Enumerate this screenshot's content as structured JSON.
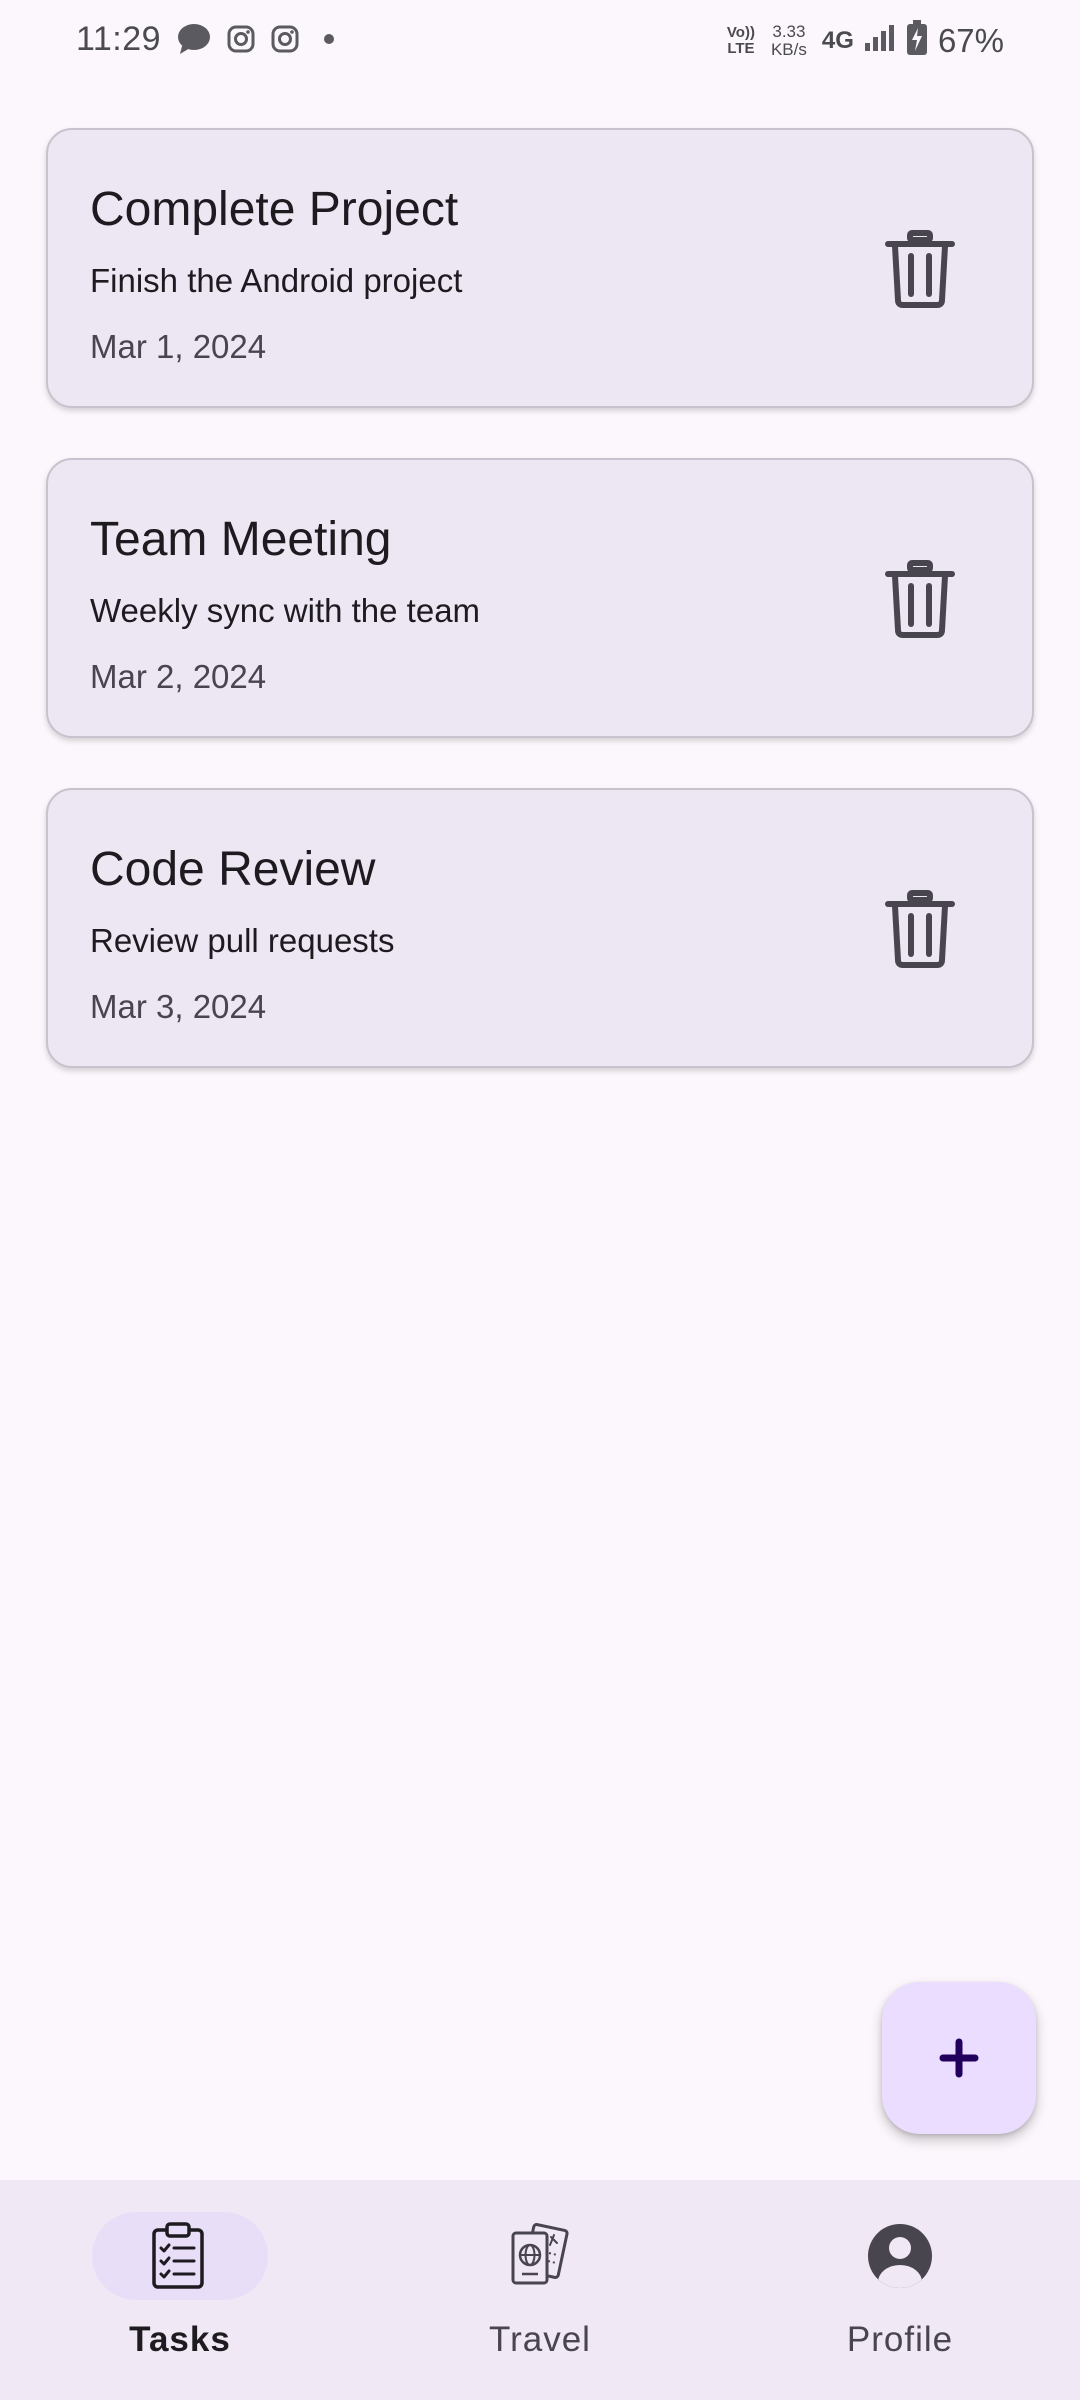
{
  "status_bar": {
    "time": "11:29",
    "volte_top": "Vo))",
    "volte_bottom": "LTE",
    "speed_value": "3.33",
    "speed_unit": "KB/s",
    "network": "4G",
    "battery": "67%",
    "left_icons": [
      "chat-bubble-icon",
      "instagram-icon",
      "instagram-icon",
      "dot-icon"
    ],
    "right_icons": [
      "signal-bars-icon",
      "battery-charging-icon"
    ]
  },
  "tasks": [
    {
      "title": "Complete Project",
      "description": "Finish the Android project",
      "date": "Mar 1, 2024"
    },
    {
      "title": "Team Meeting",
      "description": "Weekly sync with the team",
      "date": "Mar 2, 2024"
    },
    {
      "title": "Code Review",
      "description": "Review pull requests",
      "date": "Mar 3, 2024"
    }
  ],
  "fab": {
    "icon": "plus-icon"
  },
  "nav": {
    "items": [
      {
        "label": "Tasks",
        "icon": "clipboard-checklist-icon",
        "selected": true
      },
      {
        "label": "Travel",
        "icon": "passport-icon",
        "selected": false
      },
      {
        "label": "Profile",
        "icon": "account-circle-icon",
        "selected": false
      }
    ]
  },
  "colors": {
    "background": "#FCF7FC",
    "card": "#EDE6F3",
    "card_border": "#C9C2CE",
    "fab": "#EADDFF",
    "fab_icon": "#21005D",
    "nav_bar": "#F0E8F5",
    "nav_indicator": "#E8DEF8",
    "text_primary": "#1D1B20",
    "text_secondary": "#49454F"
  }
}
